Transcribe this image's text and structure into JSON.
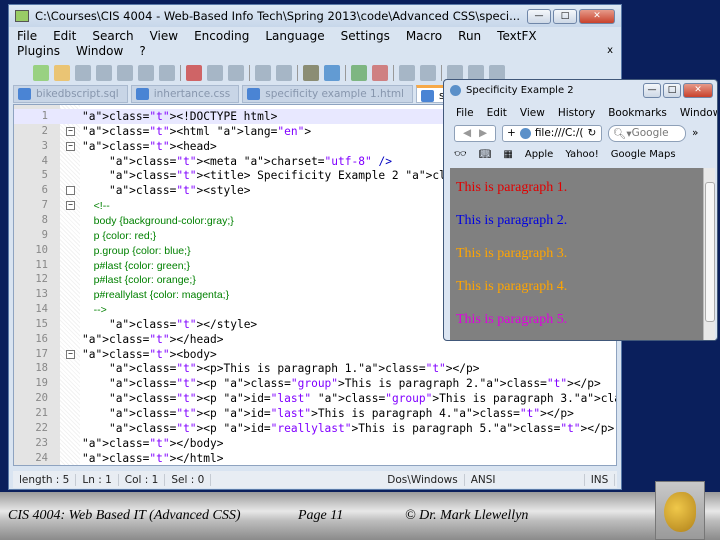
{
  "npp": {
    "title": "C:\\Courses\\CIS 4004 - Web-Based Info Tech\\Spring 2013\\code\\Advanced CSS\\speci...",
    "menu": [
      "File",
      "Edit",
      "Search",
      "View",
      "Encoding",
      "Language",
      "Settings",
      "Macro",
      "Run",
      "TextFX",
      "Plugins",
      "Window",
      "?"
    ],
    "menu_close": "x",
    "tabs": [
      "bikedbscript.sql",
      "inhertance.css",
      "specificity example 1.html",
      "spec"
    ],
    "status": [
      "length : 5",
      "Ln : 1",
      "Col : 1",
      "Sel : 0",
      "Dos\\Windows",
      "ANSI",
      "INS"
    ]
  },
  "code_lines": [
    {
      "n": "1",
      "t": "<!DOCTYPE html>"
    },
    {
      "n": "2",
      "t": "<html lang=\"en\">"
    },
    {
      "n": "3",
      "t": "<head>"
    },
    {
      "n": "4",
      "t": "    <meta charset=\"utf-8\" />"
    },
    {
      "n": "5",
      "t": "    <title> Specificity Example 2 </title>"
    },
    {
      "n": "6",
      "t": "    <style>"
    },
    {
      "n": "7",
      "t": "    <!--"
    },
    {
      "n": "8",
      "t": "    body {background-color:gray;}"
    },
    {
      "n": "9",
      "t": "    p {color: red;}"
    },
    {
      "n": "10",
      "t": "    p.group {color: blue;}"
    },
    {
      "n": "11",
      "t": "    p#last {color: green;}"
    },
    {
      "n": "12",
      "t": "    p#last {color: orange;}"
    },
    {
      "n": "13",
      "t": "    p#reallylast {color: magenta;}"
    },
    {
      "n": "14",
      "t": "    -->"
    },
    {
      "n": "15",
      "t": "    </style>"
    },
    {
      "n": "16",
      "t": "</head>"
    },
    {
      "n": "17",
      "t": "<body>"
    },
    {
      "n": "18",
      "t": "    <p>This is paragraph 1.</p>"
    },
    {
      "n": "19",
      "t": "    <p class=\"group\">This is paragraph 2.</p>"
    },
    {
      "n": "20",
      "t": "    <p id=\"last\" class=\"group\">This is paragraph 3.</p>"
    },
    {
      "n": "21",
      "t": "    <p id=\"last\">This is paragraph 4.</p>"
    },
    {
      "n": "22",
      "t": "    <p id=\"reallylast\">This is paragraph 5.</p>"
    },
    {
      "n": "23",
      "t": "</body>"
    },
    {
      "n": "24",
      "t": "</html>"
    }
  ],
  "browser": {
    "title": "Specificity Example 2",
    "menu": [
      "File",
      "Edit",
      "View",
      "History",
      "Bookmarks",
      "Window",
      "Help"
    ],
    "url": "file:///C:/(",
    "search_placeholder": "Google",
    "bookmarks": [
      "Apple",
      "Yahoo!",
      "Google Maps"
    ],
    "paragraphs": [
      {
        "text": "This is paragraph 1.",
        "color": "#e00000"
      },
      {
        "text": "This is paragraph 2.",
        "color": "#0000e0"
      },
      {
        "text": "This is paragraph 3.",
        "color": "#ffa500"
      },
      {
        "text": "This is paragraph 4.",
        "color": "#ffa500"
      },
      {
        "text": "This is paragraph 5.",
        "color": "#e000e0"
      }
    ]
  },
  "footer": {
    "course": "CIS 4004: Web Based IT (Advanced CSS)",
    "page": "Page 11",
    "author": "© Dr. Mark Llewellyn"
  }
}
